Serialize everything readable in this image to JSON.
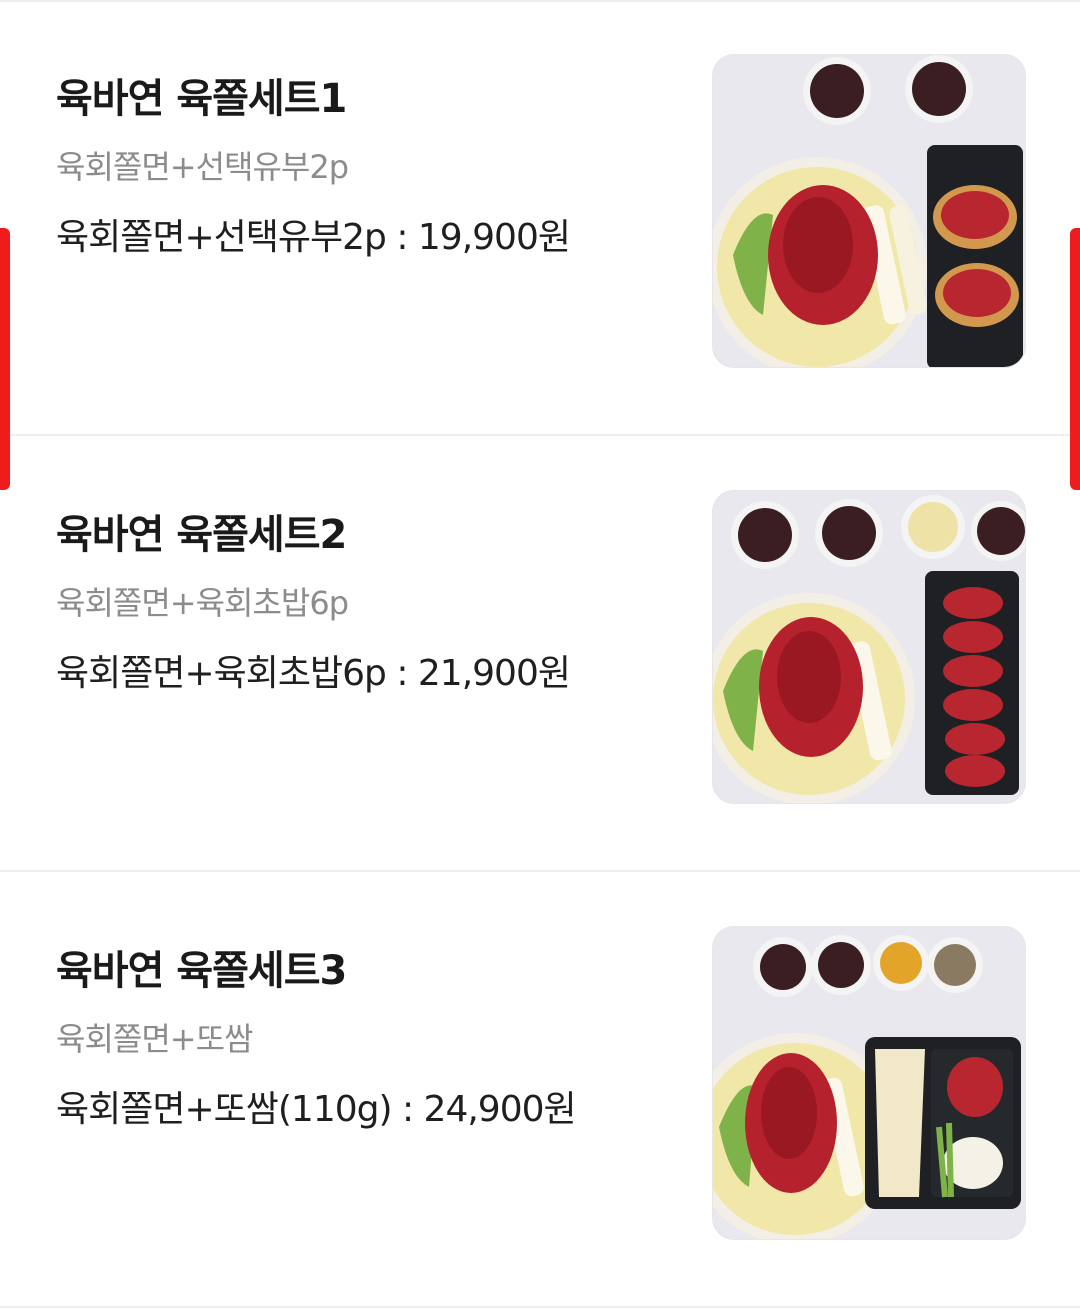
{
  "menu": {
    "items": [
      {
        "name": "육바연 육쫄세트1",
        "description": "육회쫄면+선택유부2p",
        "price_line": "육회쫄면+선택유부2p : 19,900원",
        "photo_icon": "food-photo-icon"
      },
      {
        "name": "육바연 육쫄세트2",
        "description": "육회쫄면+육회초밥6p",
        "price_line": "육회쫄면+육회초밥6p : 21,900원",
        "photo_icon": "food-photo-icon"
      },
      {
        "name": "육바연 육쫄세트3",
        "description": "육회쫄면+또쌈",
        "price_line": "육회쫄면+또쌈(110g) : 24,900원",
        "photo_icon": "food-photo-icon"
      }
    ]
  },
  "colors": {
    "accent": "#ee1c1c",
    "title": "#1a1a1a",
    "description": "#8c8c8c",
    "divider": "#eeeeee"
  }
}
